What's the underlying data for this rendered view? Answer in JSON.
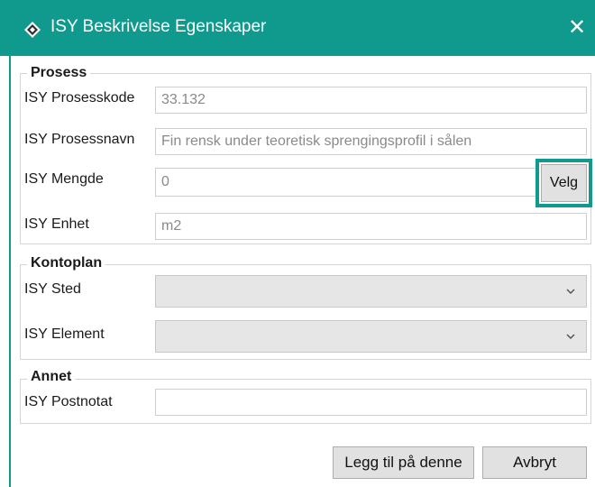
{
  "window": {
    "title": "ISY Beskrivelse Egenskaper",
    "close_glyph": "✕",
    "icon": "diamond-app-icon"
  },
  "prosess": {
    "legend": "Prosess",
    "prosesskode_label": "ISY Prosesskode",
    "prosesskode_value": "33.132",
    "prosessnavn_label": "ISY Prosessnavn",
    "prosessnavn_value": "Fin rensk under teoretisk sprengingsprofil i sålen",
    "mengde_label": "ISY Mengde",
    "mengde_value": "0",
    "velg_label": "Velg",
    "enhet_label": "ISY Enhet",
    "enhet_value": "m2"
  },
  "kontoplan": {
    "legend": "Kontoplan",
    "sted_label": "ISY Sted",
    "sted_value": "",
    "element_label": "ISY Element",
    "element_value": ""
  },
  "annet": {
    "legend": "Annet",
    "postnotat_label": "ISY Postnotat",
    "postnotat_value": ""
  },
  "buttons": {
    "add_label": "Legg til på denne",
    "cancel_label": "Avbryt"
  },
  "colors": {
    "accent": "#0f9a8d",
    "highlight": "#0f9a8d"
  }
}
